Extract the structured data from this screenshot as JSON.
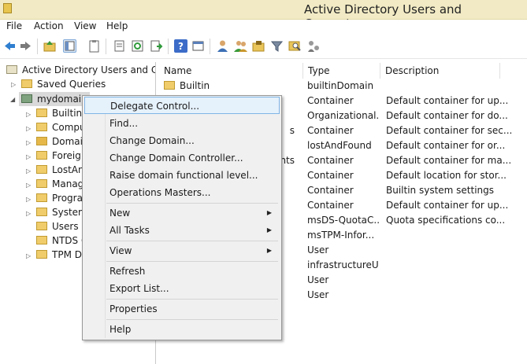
{
  "window": {
    "title": "Active Directory Users and Computers"
  },
  "menubar": [
    "File",
    "Action",
    "View",
    "Help"
  ],
  "toolbar": {
    "icons": [
      "back-arrow-icon",
      "forward-arrow-icon",
      "up-folder-icon",
      "show-hide-tree-icon",
      "clipboard-icon",
      "properties-icon",
      "refresh-icon",
      "export-list-icon",
      "help-icon",
      "console-icon",
      "user-icon",
      "group-icon",
      "ou-icon",
      "filter-icon",
      "search-icon",
      "delegate-icon"
    ]
  },
  "tree": {
    "root": "Active Directory Users and Com",
    "saved_queries": "Saved Queries",
    "domain": "mydomain",
    "children": [
      "Builtin",
      "Compu",
      "Domai",
      "Foreig",
      "LostAn",
      "Manag",
      "Progra",
      "System",
      "Users",
      "NTDS C",
      "TPM D"
    ]
  },
  "list": {
    "columns": [
      "Name",
      "Type",
      "Description"
    ],
    "rows": [
      {
        "name": "Builtin",
        "type": "builtinDomain",
        "desc": ""
      },
      {
        "name": "",
        "type": "Container",
        "desc": "Default container for up..."
      },
      {
        "name": "",
        "type": "Organizational...",
        "desc": "Default container for do..."
      },
      {
        "name": "s",
        "type": "Container",
        "desc": "Default container for sec..."
      },
      {
        "name": "",
        "type": "lostAndFound",
        "desc": "Default container for or..."
      },
      {
        "name": "nts",
        "type": "Container",
        "desc": "Default container for ma..."
      },
      {
        "name": "",
        "type": "Container",
        "desc": "Default location for stor..."
      },
      {
        "name": "",
        "type": "Container",
        "desc": "Builtin system settings"
      },
      {
        "name": "",
        "type": "Container",
        "desc": "Default container for up..."
      },
      {
        "name": "",
        "type": "msDS-QuotaC...",
        "desc": "Quota specifications co..."
      },
      {
        "name": "",
        "type": "msTPM-Infor...",
        "desc": ""
      },
      {
        "name": "",
        "type": "User",
        "desc": ""
      },
      {
        "name": "",
        "type": "infrastructureU...",
        "desc": ""
      },
      {
        "name": "",
        "type": "User",
        "desc": ""
      },
      {
        "name": "",
        "type": "User",
        "desc": ""
      }
    ]
  },
  "context_menu": {
    "delegate_control": "Delegate Control...",
    "find": "Find...",
    "change_domain": "Change Domain...",
    "change_dc": "Change Domain Controller...",
    "raise_level": "Raise domain functional level...",
    "operations_masters": "Operations Masters...",
    "new": "New",
    "all_tasks": "All Tasks",
    "view": "View",
    "refresh": "Refresh",
    "export_list": "Export List...",
    "properties": "Properties",
    "help": "Help"
  }
}
